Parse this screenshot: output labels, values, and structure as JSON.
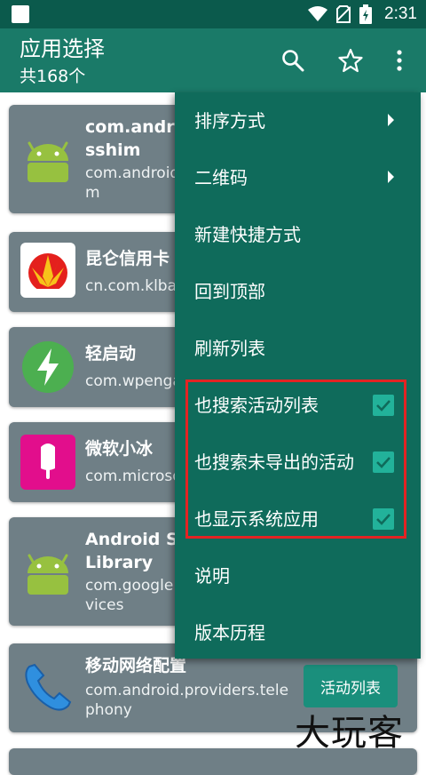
{
  "status_bar": {
    "time": "2:31"
  },
  "app_bar": {
    "title": "应用选择",
    "subtitle": "共168个"
  },
  "apps": [
    {
      "title": "com.android.\nsshim",
      "package": "com.android\nm",
      "icon": "android-icon"
    },
    {
      "title": "昆仑信用卡",
      "package": "cn.com.klbank",
      "icon": "petrochina-logo"
    },
    {
      "title": "轻启动",
      "package": "com.wpengapp",
      "icon": "lightning-icon"
    },
    {
      "title": "微软小冰",
      "package": "com.microsoft",
      "icon": "popsicle-icon"
    },
    {
      "title": "Android Se\nLibrary",
      "package": "com.google.\nvices",
      "icon": "android-icon"
    },
    {
      "title": "移动网络配置",
      "package": "com.android.providers.tele\nphony",
      "icon": "phone-icon",
      "button": "活动列表"
    }
  ],
  "menu": {
    "items": [
      {
        "label": "排序方式",
        "type": "submenu"
      },
      {
        "label": "二维码",
        "type": "submenu"
      },
      {
        "label": "新建快捷方式",
        "type": "action"
      },
      {
        "label": "回到顶部",
        "type": "action"
      },
      {
        "label": "刷新列表",
        "type": "action"
      },
      {
        "label": "也搜索活动列表",
        "type": "checkbox",
        "checked": true
      },
      {
        "label": "也搜索未导出的活动",
        "type": "checkbox",
        "checked": true
      },
      {
        "label": "也显示系统应用",
        "type": "checkbox",
        "checked": true
      },
      {
        "label": "说明",
        "type": "action"
      },
      {
        "label": "版本历程",
        "type": "action"
      }
    ]
  },
  "watermark": "大玩客",
  "colors": {
    "status_bar": "#0b5a4c",
    "app_bar": "#1a7a68",
    "menu": "#0f6b5b",
    "card": "#6f7f86",
    "check": "#22b29a",
    "highlight": "#e32323"
  }
}
